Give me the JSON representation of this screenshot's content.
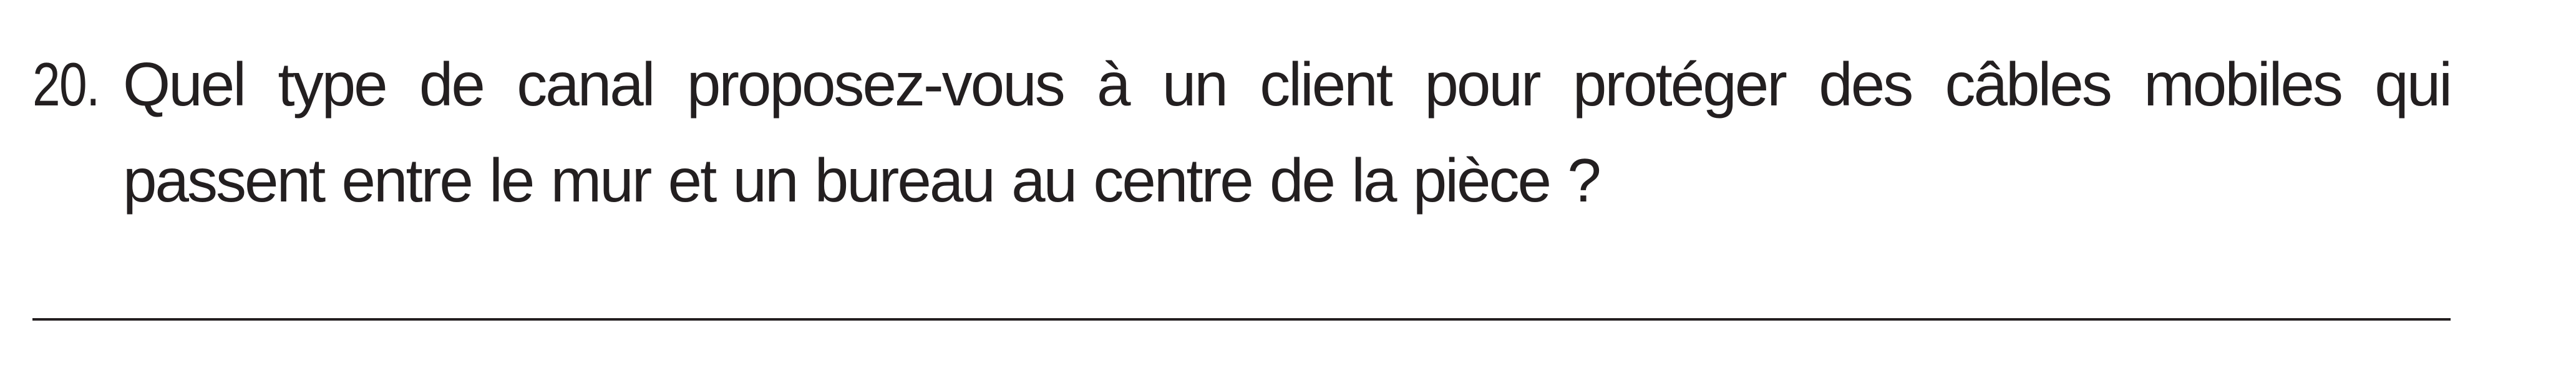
{
  "question": {
    "number": "20.",
    "text": "Quel type de canal proposez-vous à un client pour protéger des câbles mobiles qui passent entre le mur et un bureau au centre de la pièce ?"
  }
}
